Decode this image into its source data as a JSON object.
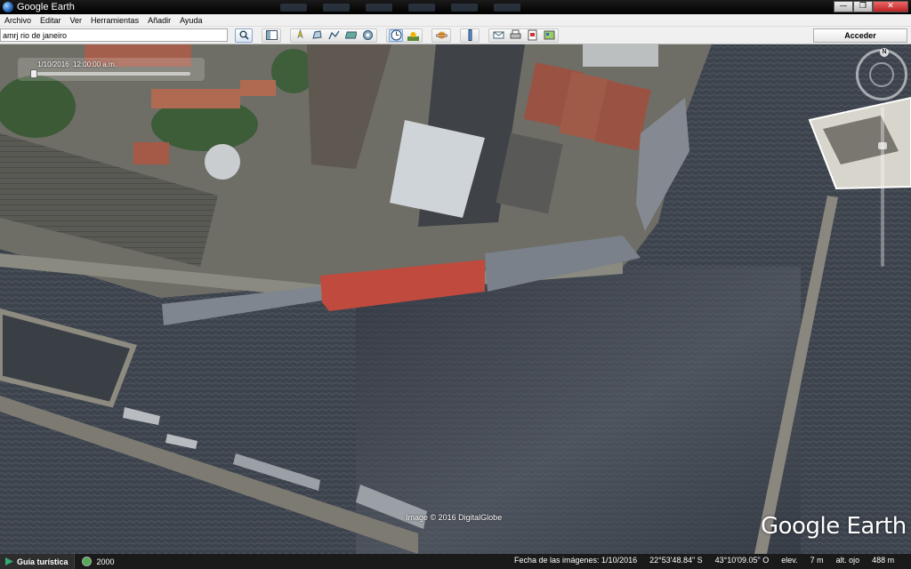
{
  "window": {
    "title": "Google Earth",
    "buttons": {
      "minimize": "—",
      "maximize": "❐",
      "close": "✕"
    }
  },
  "menu": [
    "Archivo",
    "Editar",
    "Ver",
    "Herramientas",
    "Añadir",
    "Ayuda"
  ],
  "search": {
    "value": "amrj rio de janeiro"
  },
  "toolbar": {
    "sidebar_button": "sidebar-icon",
    "tools": [
      "placemark-icon",
      "polygon-icon",
      "path-icon",
      "overlay-icon",
      "record-tour-icon",
      "historical-imagery-icon",
      "sun-icon",
      "planets-icon",
      "ruler-icon",
      "email-icon",
      "print-icon",
      "save-image-icon",
      "view-in-maps-icon"
    ],
    "active_tool": "historical-imagery-icon",
    "signin_label": "Acceder"
  },
  "map": {
    "time_slider": {
      "date": "1/10/2016",
      "time": "12:00:00 a.m."
    },
    "compass_label": "N",
    "copyright": "Image © 2016 DigitalGlobe",
    "logo": "Google Earth"
  },
  "status": {
    "tour_guide": "Guía turística",
    "history_year": "2000",
    "imagery_date": "Fecha de las imágenes: 1/10/2016",
    "lat": "22°53'48.84\" S",
    "lon": "43°10'09.05\" O",
    "elev": "elev.",
    "elev_value": "7 m",
    "eye_alt_label": "alt. ojo",
    "eye_alt": "488 m"
  },
  "colors": {
    "water": "#3f4550",
    "dock": "#6b6b63",
    "roof_red": "#a05a48",
    "hull_red": "#c0453a",
    "ship_grey": "#7a8088"
  }
}
